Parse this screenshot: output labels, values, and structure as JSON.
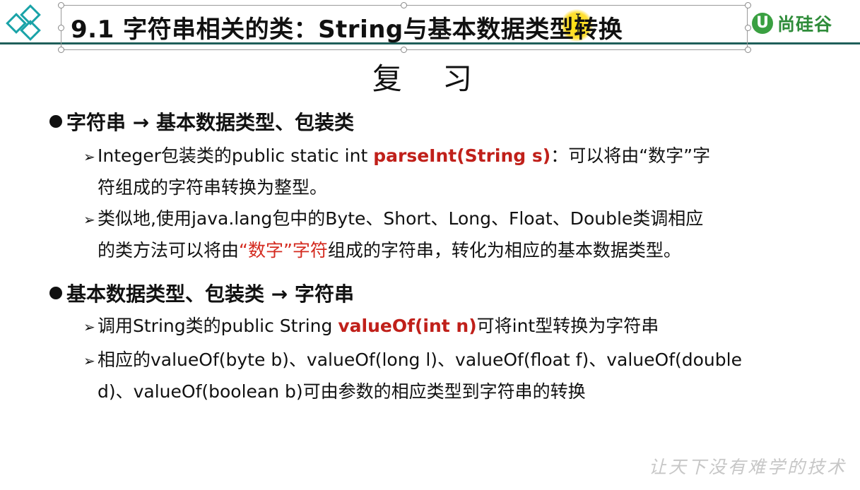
{
  "slide": {
    "title": "9.1 字符串相关的类：String与基本数据类型转换",
    "brand": {
      "mark": "U",
      "name": "尚硅谷"
    },
    "heading": "复 习",
    "sections": [
      {
        "bullet": "字符串 → 基本数据类型、包装类",
        "items": [
          {
            "before": "Integer包装类的public static int ",
            "emph": "parseInt(String s)",
            "after": "：可以将由“数字”字",
            "cont": "符组成的字符串转换为整型。"
          },
          {
            "line1": "类似地,使用java.lang包中的Byte、Short、Long、Float、Double类调相应",
            "cont_before": "的类方法可以将由",
            "cont_emph": "“数字”字符",
            "cont_after": "组成的字符串，转化为相应的基本数据类型。"
          }
        ]
      },
      {
        "bullet": "基本数据类型、包装类 → 字符串",
        "items": [
          {
            "before": "调用String类的public String ",
            "emph": "valueOf(int n)",
            "after": "可将int型转换为字符串"
          },
          {
            "line1": "相应的valueOf(byte b)、valueOf(long l)、valueOf(float f)、valueOf(double",
            "cont": "d)、valueOf(boolean b)可由参数的相应类型到字符串的转换"
          }
        ]
      }
    ],
    "watermark": "让天下没有难学的技术"
  },
  "icons": {
    "logo": "diamond-logo-icon",
    "cursor": "text-cursor-icon",
    "arrow": "arrow-right-icon"
  },
  "colors": {
    "emphasis": "#c0201a",
    "header_line": "#1f5f5a",
    "logo": "#1aa3a8",
    "brand": "#2f8c3a",
    "highlight": "#ffd400"
  }
}
